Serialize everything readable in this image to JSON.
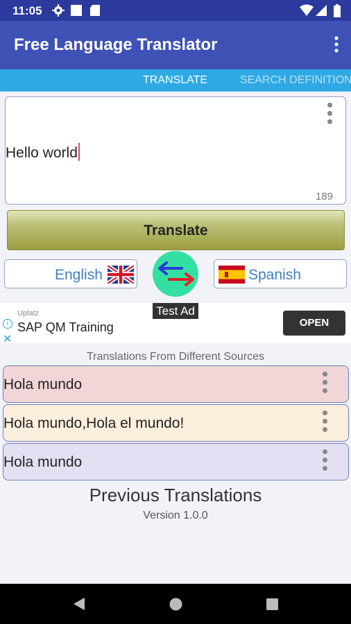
{
  "status_bar": {
    "time": "11:05"
  },
  "app_bar": {
    "title": "Free Language Translator"
  },
  "tabs": [
    {
      "label": "TRANSLATE",
      "active": true
    },
    {
      "label": "SEARCH DEFINITION",
      "active": false
    }
  ],
  "input": {
    "text": "Hello world",
    "remaining_chars": "189"
  },
  "translate_button": {
    "label": "Translate"
  },
  "languages": {
    "source": "English",
    "target": "Spanish"
  },
  "ad": {
    "test_label": "Test Ad",
    "brand": "Uplatz",
    "title": "SAP QM Training",
    "cta": "OPEN"
  },
  "results": {
    "header": "Translations From Different Sources",
    "items": [
      {
        "text": "Hola mundo",
        "color": "#f2d6d7"
      },
      {
        "text": "Hola mundo,Hola el mundo!",
        "color": "#fbeedd"
      },
      {
        "text": "Hola mundo",
        "color": "#e4e0f3"
      }
    ]
  },
  "footer": {
    "previous_label": "Previous Translations",
    "version": "Version 1.0.0"
  },
  "colors": {
    "primary": "#3f51b5",
    "status": "#2b3a9c",
    "tabs": "#2fa9e3",
    "swap": "#34e0a1"
  }
}
